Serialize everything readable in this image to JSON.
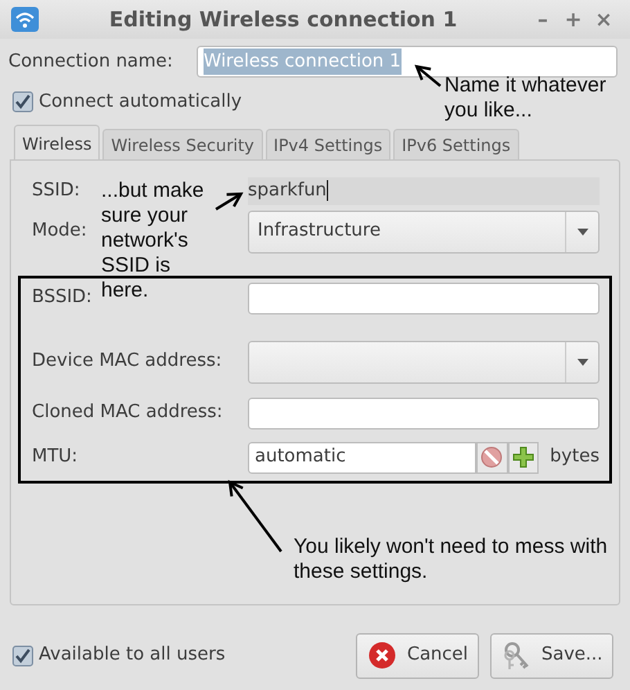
{
  "window": {
    "title": "Editing Wireless connection 1",
    "controls": [
      "–",
      "+",
      "×"
    ]
  },
  "connection_name": {
    "label": "Connection name:",
    "value": "Wireless connection 1",
    "text_selected": true
  },
  "connect_automatically": {
    "label": "Connect automatically",
    "checked": true
  },
  "tabs": [
    {
      "label": "Wireless",
      "selected": true
    },
    {
      "label": "Wireless Security",
      "selected": false
    },
    {
      "label": "IPv4 Settings",
      "selected": false
    },
    {
      "label": "IPv6 Settings",
      "selected": false
    }
  ],
  "wireless": {
    "rows": [
      {
        "kind": "flat",
        "label": "SSID:",
        "value": "sparkfun"
      },
      {
        "kind": "combo",
        "label": "Mode:",
        "value": "Infrastructure"
      }
    ],
    "highlighted_rows": [
      {
        "kind": "entry",
        "label": "BSSID:"
      },
      {
        "kind": "combo",
        "label": "Device MAC address:"
      },
      {
        "kind": "entry",
        "label": "Cloned MAC address:"
      },
      {
        "kind": "spin",
        "label": "MTU:",
        "value": "automatic",
        "unit": "bytes",
        "decrease_disabled": true
      }
    ]
  },
  "available_to_all_users": {
    "label": "Available to all users",
    "checked": true
  },
  "buttons": [
    {
      "kind": "cancel",
      "label": "Cancel"
    },
    {
      "kind": "save",
      "label": "Save..."
    }
  ],
  "annotations": [
    {
      "text": "Name it whatever you like..."
    },
    {
      "text": "...but make sure your network's SSID is here."
    },
    {
      "text": "You likely won't need to mess with these settings."
    }
  ]
}
